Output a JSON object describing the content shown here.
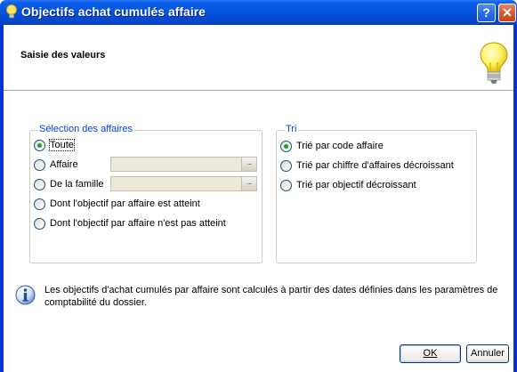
{
  "window": {
    "title": "Objectifs achat cumulés affaire",
    "help_label": "?",
    "close_label": "✕"
  },
  "header": {
    "title": "Saisie des valeurs"
  },
  "selection": {
    "legend": "Sélection des affaires",
    "options": [
      {
        "label": "Toute",
        "checked": true
      },
      {
        "label": "Affaire",
        "checked": false
      },
      {
        "label": "De la famille",
        "checked": false
      },
      {
        "label": "Dont l'objectif par affaire est atteint",
        "checked": false
      },
      {
        "label": "Dont l'objectif par affaire n'est pas atteint",
        "checked": false
      }
    ],
    "affaire_value": "",
    "famille_value": "",
    "browse_label": "..."
  },
  "tri": {
    "legend": "Tri",
    "options": [
      {
        "label": "Trié par code affaire",
        "checked": true
      },
      {
        "label": "Trié par chiffre d'affaires décroissant",
        "checked": false
      },
      {
        "label": "Trié par objectif décroissant",
        "checked": false
      }
    ]
  },
  "info": {
    "text": "Les objectifs d'achat cumulés par affaire sont calculés à partir des dates définies dans les paramètres de comptabilité du dossier."
  },
  "buttons": {
    "ok": "OK",
    "cancel": "Annuler"
  }
}
